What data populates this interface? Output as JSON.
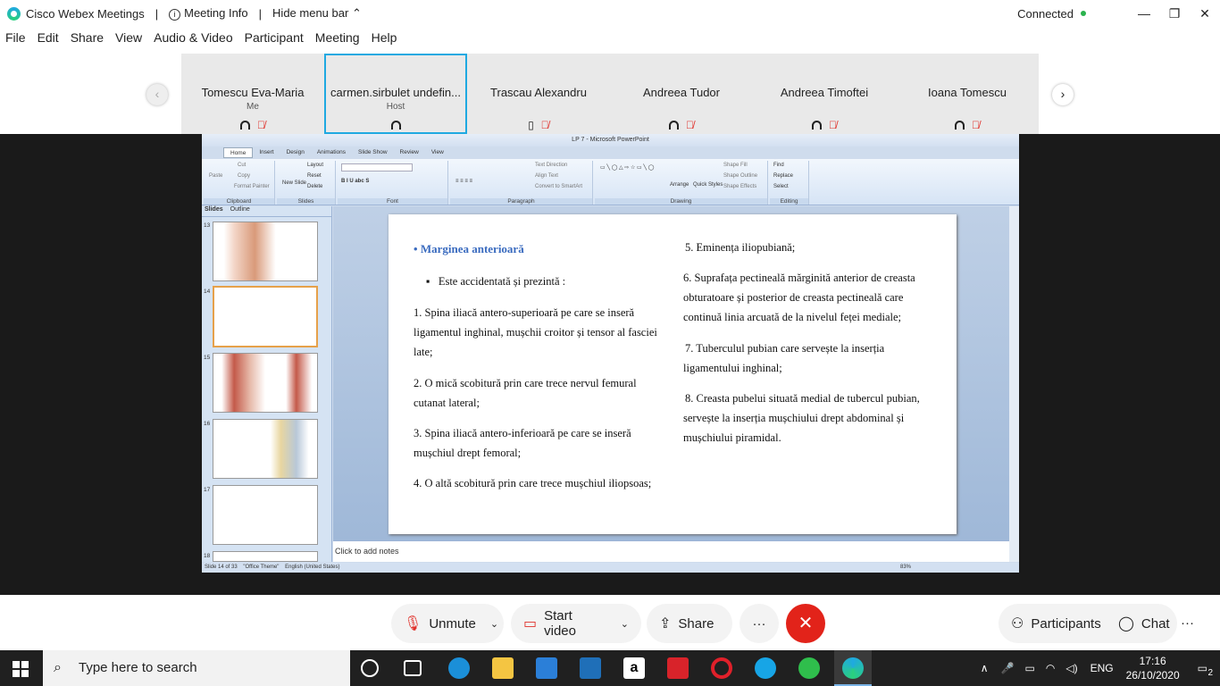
{
  "titlebar": {
    "app_name": "Cisco Webex Meetings",
    "meeting_info": "Meeting Info",
    "hide_menu": "Hide menu bar",
    "status": "Connected"
  },
  "menu": [
    "File",
    "Edit",
    "Share",
    "View",
    "Audio & Video",
    "Participant",
    "Meeting",
    "Help"
  ],
  "participants": [
    {
      "name": "Tomescu Eva-Maria",
      "role": "Me"
    },
    {
      "name": "carmen.sirbulet undefin...",
      "role": "Host"
    },
    {
      "name": "Trascau Alexandru",
      "role": ""
    },
    {
      "name": "Andreea Tudor",
      "role": ""
    },
    {
      "name": "Andreea Timoftei",
      "role": ""
    },
    {
      "name": "Ioana Tomescu",
      "role": ""
    }
  ],
  "ppt": {
    "title": "LP 7 - Microsoft PowerPoint",
    "tabs": [
      "Home",
      "Insert",
      "Design",
      "Animations",
      "Slide Show",
      "Review",
      "View"
    ],
    "groups": [
      "Clipboard",
      "Slides",
      "Font",
      "Paragraph",
      "Drawing",
      "Editing"
    ],
    "clipboard_items": [
      "Cut",
      "Copy",
      "Format Painter",
      "Paste"
    ],
    "slides_items": [
      "Layout",
      "Reset",
      "Delete",
      "New Slide"
    ],
    "paragraph_items": [
      "Text Direction",
      "Align Text",
      "Convert to SmartArt"
    ],
    "drawing_items": [
      "Shape Fill",
      "Shape Outline",
      "Shape Effects",
      "Arrange",
      "Quick Styles"
    ],
    "editing_items": [
      "Find",
      "Replace",
      "Select"
    ],
    "panel_tabs": [
      "Slides",
      "Outline"
    ],
    "thumb_numbers": [
      "13",
      "14",
      "15",
      "16",
      "17",
      "18"
    ],
    "notes": "Click to add notes",
    "status_slide": "Slide 14 of 33",
    "status_theme": "\"Office Theme\"",
    "status_lang": "English (United States)",
    "zoom": "83%"
  },
  "slide": {
    "heading": "Marginea anterioară",
    "bullet": "Este accidentată și prezintă :",
    "left_lines": [
      "1. Spina iliacă antero-superioară pe care se inseră",
      "ligamentul inghinal, mușchii croitor și tensor al fasciei",
      "late;",
      "2. O mică scobitură prin care trece nervul femural",
      "cutanat lateral;",
      "3. Spina iliacă antero-inferioară pe care se inseră",
      "mușchiul drept femoral;",
      "4. O altă scobitură prin care trece mușchiul iliopsoas;"
    ],
    "right_lines": [
      "5. Eminența iliopubiană;",
      "6. Suprafața pectineală mărginită anterior de creasta",
      "obturatoare și posterior de creasta pectineală care",
      "continuă linia arcuată de la nivelul feței mediale;",
      "7. Tuberculul pubian care servește la inserția",
      "ligamentului inghinal;",
      "8. Creasta pubelui situată medial de tubercul pubian,",
      "servește la inserția mușchiului drept abdominal și",
      "mușchiului piramidal."
    ]
  },
  "controls": {
    "unmute": "Unmute",
    "start_video": "Start video",
    "share": "Share",
    "more": "···",
    "participants": "Participants",
    "chat": "Chat"
  },
  "taskbar": {
    "search_placeholder": "Type here to search",
    "lang": "ENG",
    "time": "17:16",
    "date": "26/10/2020",
    "notifications": "2"
  }
}
